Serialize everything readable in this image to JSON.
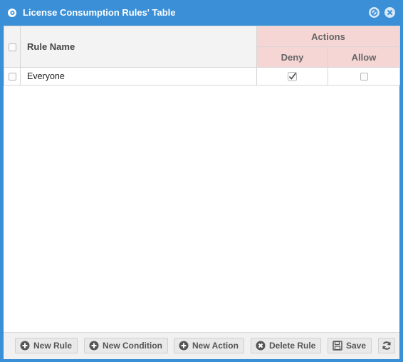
{
  "window": {
    "title": "License Consumption Rules' Table"
  },
  "table": {
    "headers": {
      "rule_name": "Rule Name",
      "actions": "Actions",
      "deny": "Deny",
      "allow": "Allow"
    },
    "rows": [
      {
        "name": "Everyone",
        "deny": true,
        "allow": false,
        "selected": false
      }
    ]
  },
  "toolbar": {
    "new_rule": "New Rule",
    "new_condition": "New Condition",
    "new_action": "New Action",
    "delete_rule": "Delete Rule",
    "save": "Save"
  },
  "colors": {
    "titlebar": "#3a8fd6",
    "actions_header": "#f6d5d5"
  }
}
